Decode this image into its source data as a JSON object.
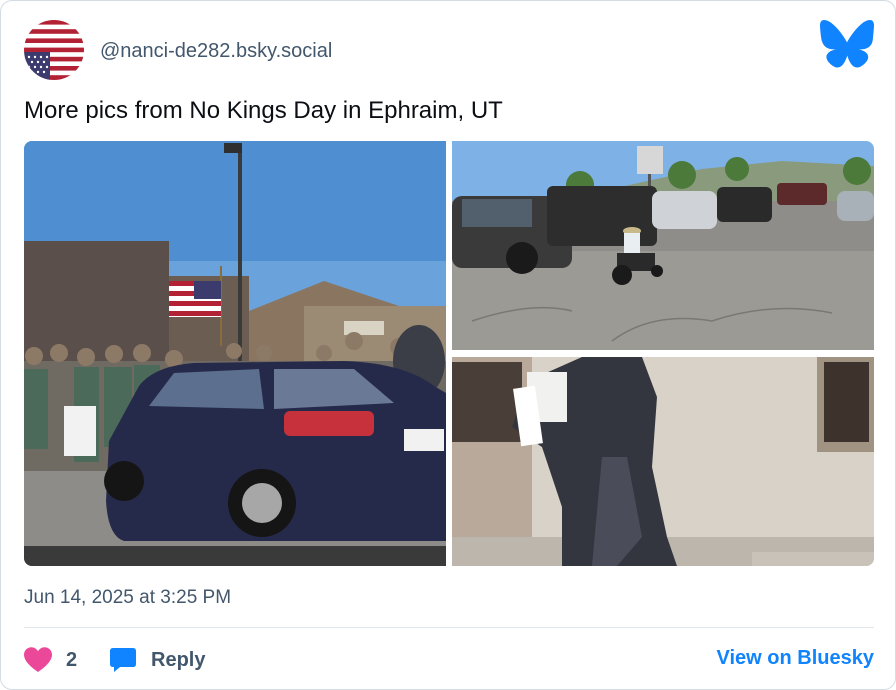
{
  "post": {
    "handle": "@nanci-de282.bsky.social",
    "text": "More pics from No Kings Day in Ephraim, UT",
    "timestamp": "Jun 14, 2025 at 3:25 PM",
    "like_count": "2",
    "reply_label": "Reply",
    "view_label": "View on Bluesky"
  },
  "photos": [
    {
      "subject": "car-and-protest-crowd-photo"
    },
    {
      "subject": "parking-lot-wheelchair-photo"
    },
    {
      "subject": "inflatable-costume-sign-photo"
    }
  ],
  "colors": {
    "accent": "#1083fe",
    "heart": "#ec4899",
    "muted": "#42576c"
  }
}
